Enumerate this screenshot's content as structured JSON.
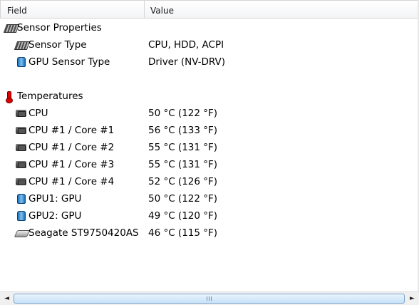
{
  "header": {
    "field": "Field",
    "value": "Value"
  },
  "rows": [
    {
      "icon": "chip-sensor-icon",
      "label": "Sensor Properties",
      "value": ""
    },
    {
      "icon": "sensor-icon",
      "label": "Sensor Type",
      "value": "CPU, HDD, ACPI"
    },
    {
      "icon": "gpu-icon",
      "label": "GPU Sensor Type",
      "value": "Driver  (NV-DRV)"
    },
    {
      "icon": "thermometer-icon",
      "label": "Temperatures",
      "value": ""
    },
    {
      "icon": "cpu-icon",
      "label": "CPU",
      "value": "50 °C  (122 °F)"
    },
    {
      "icon": "cpu-icon",
      "label": "CPU #1 / Core #1",
      "value": "56 °C  (133 °F)"
    },
    {
      "icon": "cpu-icon",
      "label": "CPU #1 / Core #2",
      "value": "55 °C  (131 °F)"
    },
    {
      "icon": "cpu-icon",
      "label": "CPU #1 / Core #3",
      "value": "55 °C  (131 °F)"
    },
    {
      "icon": "cpu-icon",
      "label": "CPU #1 / Core #4",
      "value": "52 °C  (126 °F)"
    },
    {
      "icon": "gpu-icon",
      "label": "GPU1: GPU",
      "value": "50 °C  (122 °F)"
    },
    {
      "icon": "gpu-icon",
      "label": "GPU2: GPU",
      "value": "49 °C  (120 °F)"
    },
    {
      "icon": "hdd-icon",
      "label": "Seagate ST9750420AS",
      "value": "46 °C  (115 °F)"
    }
  ],
  "scrollbar": {
    "left_arrow": "◄",
    "right_arrow": "►"
  }
}
